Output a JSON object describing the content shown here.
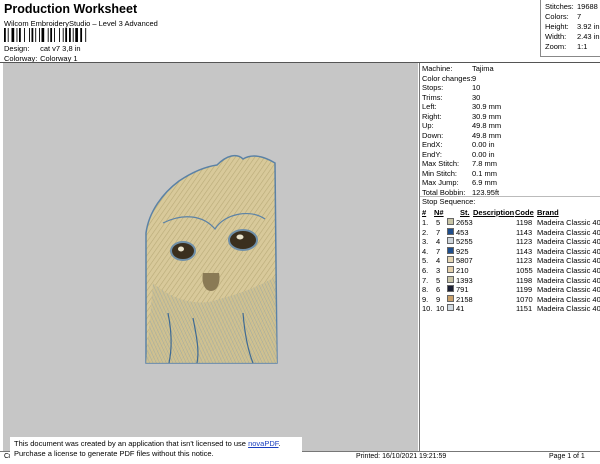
{
  "header": {
    "title": "Production Worksheet",
    "subtitle": "Wilcom EmbroideryStudio – Level 3 Advanced",
    "design_label": "Design:",
    "design_value": "cat v7 3,8 in",
    "colorway_label": "Colorway:",
    "colorway_value": "Colorway 1"
  },
  "stats": [
    {
      "label": "Stitches:",
      "value": "19688"
    },
    {
      "label": "Colors:",
      "value": "7"
    },
    {
      "label": "Height:",
      "value": "3.92 in"
    },
    {
      "label": "Width:",
      "value": "2.43 in"
    },
    {
      "label": "Zoom:",
      "value": "1:1"
    }
  ],
  "machine_info": [
    {
      "label": "Machine:",
      "value": "Tajima"
    },
    {
      "label": "Color changes:",
      "value": "9"
    },
    {
      "label": "Stops:",
      "value": "10"
    },
    {
      "label": "Trims:",
      "value": "30"
    },
    {
      "label": "Left:",
      "value": "30.9 mm"
    },
    {
      "label": "Right:",
      "value": "30.9 mm"
    },
    {
      "label": "Up:",
      "value": "49.8 mm"
    },
    {
      "label": "Down:",
      "value": "49.8 mm"
    },
    {
      "label": "EndX:",
      "value": "0.00 in"
    },
    {
      "label": "EndY:",
      "value": "0.00 in"
    },
    {
      "label": "Max Stitch:",
      "value": "7.8 mm"
    },
    {
      "label": "Min Stitch:",
      "value": "0.1 mm"
    },
    {
      "label": "Max Jump:",
      "value": "6.9 mm"
    },
    {
      "label": "Total Bobbin:",
      "value": "123.95ft"
    }
  ],
  "stop_sequence": {
    "title": "Stop Sequence:",
    "headers": {
      "num": "#",
      "n": "N#",
      "st": "St.",
      "desc": "Description",
      "code": "Code",
      "brand": "Brand"
    },
    "rows": [
      {
        "num": "1.",
        "n": "5",
        "color": "#c9c5a6",
        "st": "2653",
        "code": "1198",
        "brand": "Madeira Classic 40"
      },
      {
        "num": "2.",
        "n": "7",
        "color": "#1f4e8c",
        "st": "453",
        "code": "1143",
        "brand": "Madeira Classic 40"
      },
      {
        "num": "3.",
        "n": "4",
        "color": "#cfd6dc",
        "st": "5255",
        "code": "1123",
        "brand": "Madeira Classic 40"
      },
      {
        "num": "4.",
        "n": "7",
        "color": "#1f4e8c",
        "st": "925",
        "code": "1143",
        "brand": "Madeira Classic 40"
      },
      {
        "num": "5.",
        "n": "4",
        "color": "#e6d6b2",
        "st": "5807",
        "code": "1123",
        "brand": "Madeira Classic 40"
      },
      {
        "num": "6.",
        "n": "3",
        "color": "#e4d0aa",
        "st": "210",
        "code": "1055",
        "brand": "Madeira Classic 40"
      },
      {
        "num": "7.",
        "n": "5",
        "color": "#c9c5a6",
        "st": "1393",
        "code": "1198",
        "brand": "Madeira Classic 40"
      },
      {
        "num": "8.",
        "n": "6",
        "color": "#1b1f33",
        "st": "791",
        "code": "1199",
        "brand": "Madeira Classic 40"
      },
      {
        "num": "9.",
        "n": "9",
        "color": "#c9a06a",
        "st": "2158",
        "code": "1070",
        "brand": "Madeira Classic 40"
      },
      {
        "num": "10.",
        "n": "10",
        "color": "#d2dbe2",
        "st": "41",
        "code": "1151",
        "brand": "Madeira Classic 40"
      }
    ]
  },
  "novapdf": {
    "line1_pre": "This document was created by an application that isn't licensed to use ",
    "link": "novaPDF",
    "line1_post": ".",
    "line2": "Purchase a license to generate PDF files without this notice."
  },
  "footer": {
    "left": "Cr",
    "printed": "Printed: 16/10/2021 19:21:59",
    "page": "Page 1 of 1"
  }
}
